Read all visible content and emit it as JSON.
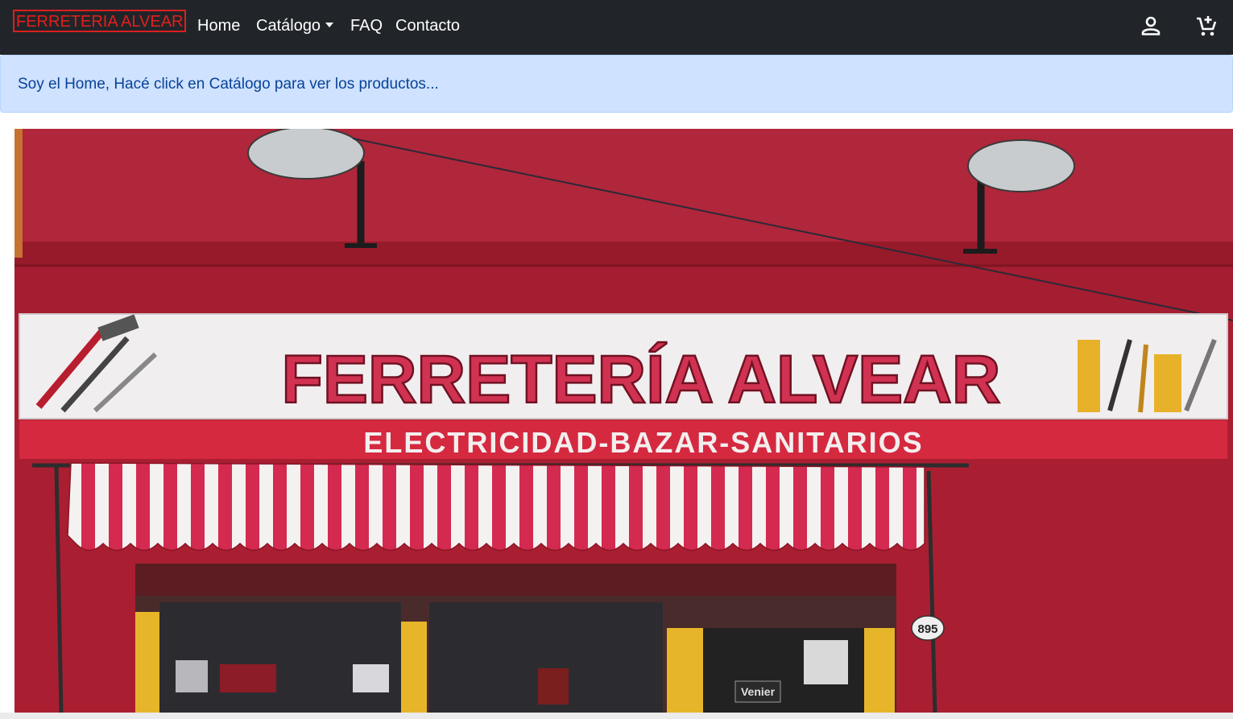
{
  "navbar": {
    "brand": "FERRETERIA ALVEAR",
    "links": [
      {
        "label": "Home"
      },
      {
        "label": "Catálogo",
        "dropdown": true
      },
      {
        "label": "FAQ"
      },
      {
        "label": "Contacto"
      }
    ],
    "icons": [
      "user-icon",
      "add-to-cart-icon"
    ],
    "colors": {
      "background": "#212529",
      "brand": "#e31e1e"
    }
  },
  "alert": {
    "message": "Soy el Home, Hacé click en Catálogo para ver los productos...",
    "colors": {
      "background": "#cfe2ff",
      "text": "#084298"
    }
  },
  "hero": {
    "sign_title": "FERRETERÍA ALVEAR",
    "sign_subtitle": "ELECTRICIDAD-BAZAR-SANITARIOS",
    "door_number": "895",
    "door_label": "Venier"
  }
}
